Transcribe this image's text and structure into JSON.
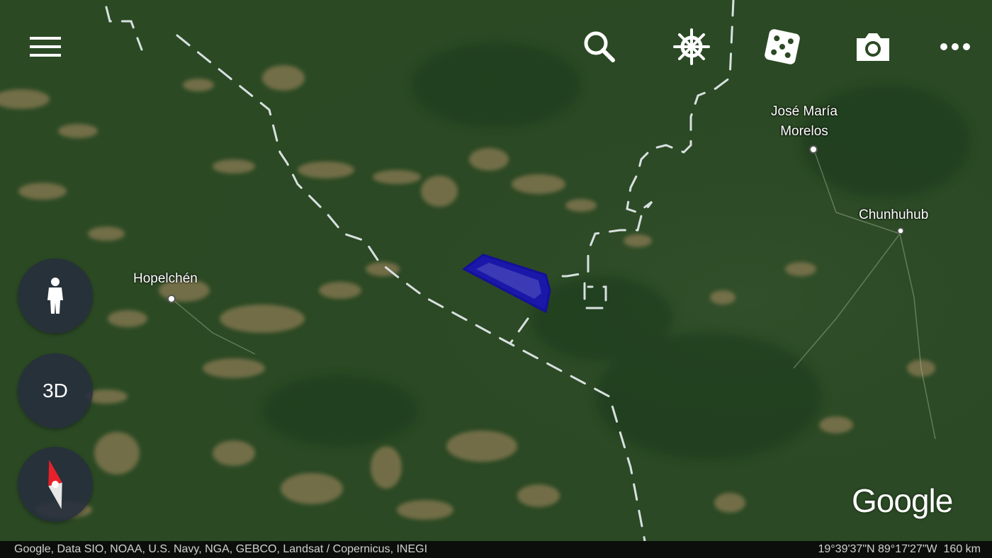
{
  "toolbar": {
    "menu_icon": "menu-icon",
    "search_icon": "search-icon",
    "voyager_icon": "ship-wheel-icon",
    "feeling_lucky_icon": "dice-icon",
    "snapshot_icon": "camera-icon",
    "more_icon": "more-options-icon"
  },
  "side_controls": {
    "street_view_icon": "pegman-icon",
    "view_toggle_label": "3D",
    "compass_icon": "compass-icon"
  },
  "places": [
    {
      "name": "Hopelchén"
    },
    {
      "name": "José María\nMorelos"
    },
    {
      "name": "Chunhuhub"
    }
  ],
  "logo": "Google",
  "attribution": "Google, Data SIO, NOAA, U.S. Navy, NGA, GEBCO, Landsat / Copernicus, INEGI",
  "status": {
    "coordinates": "19°39'37\"N 89°17'27\"W",
    "scale": "160 km"
  },
  "colors": {
    "forest": "#2b4a24",
    "cleared_land": "#8a7a52",
    "boundary": "#d8e0e0",
    "highlight_polygon": "#1a18a8"
  }
}
